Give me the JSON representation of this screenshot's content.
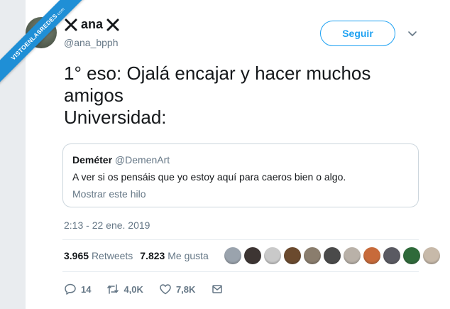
{
  "watermark": {
    "text": "VISTOENLASREDES",
    "suffix": ".com"
  },
  "author": {
    "display_name": "ana",
    "handle": "@ana_bpph",
    "name_icons": [
      "x-icon",
      "x-icon"
    ]
  },
  "follow_button": {
    "label": "Seguir"
  },
  "tweet": {
    "line1": "1° eso: Ojalá encajar y hacer muchos amigos",
    "line2": "Universidad:"
  },
  "quoted_tweet": {
    "display_name": "Deméter",
    "handle": "@DemenArt",
    "text": "A ver si os pensáis que yo estoy aquí para caeros bien o algo.",
    "show_thread": "Mostrar este hilo"
  },
  "timestamp": "2:13 - 22 ene. 2019",
  "stats": {
    "retweets_count": "3.965",
    "retweets_label": "Retweets",
    "likes_count": "7.823",
    "likes_label": "Me gusta"
  },
  "liker_avatar_colors": [
    "#9aa3ad",
    "#3d3533",
    "#c9c9c9",
    "#6b4a2e",
    "#8a7d6d",
    "#4a4a4a",
    "#b9b1a8",
    "#c76a3a",
    "#5a5a62",
    "#2f6a3a",
    "#c7b9a9"
  ],
  "actions": {
    "replies": "14",
    "retweets": "4,0K",
    "likes": "7,8K"
  },
  "colors": {
    "accent": "#1da1f2",
    "text_secondary": "#657786",
    "ribbon": "#1f8fd6"
  }
}
